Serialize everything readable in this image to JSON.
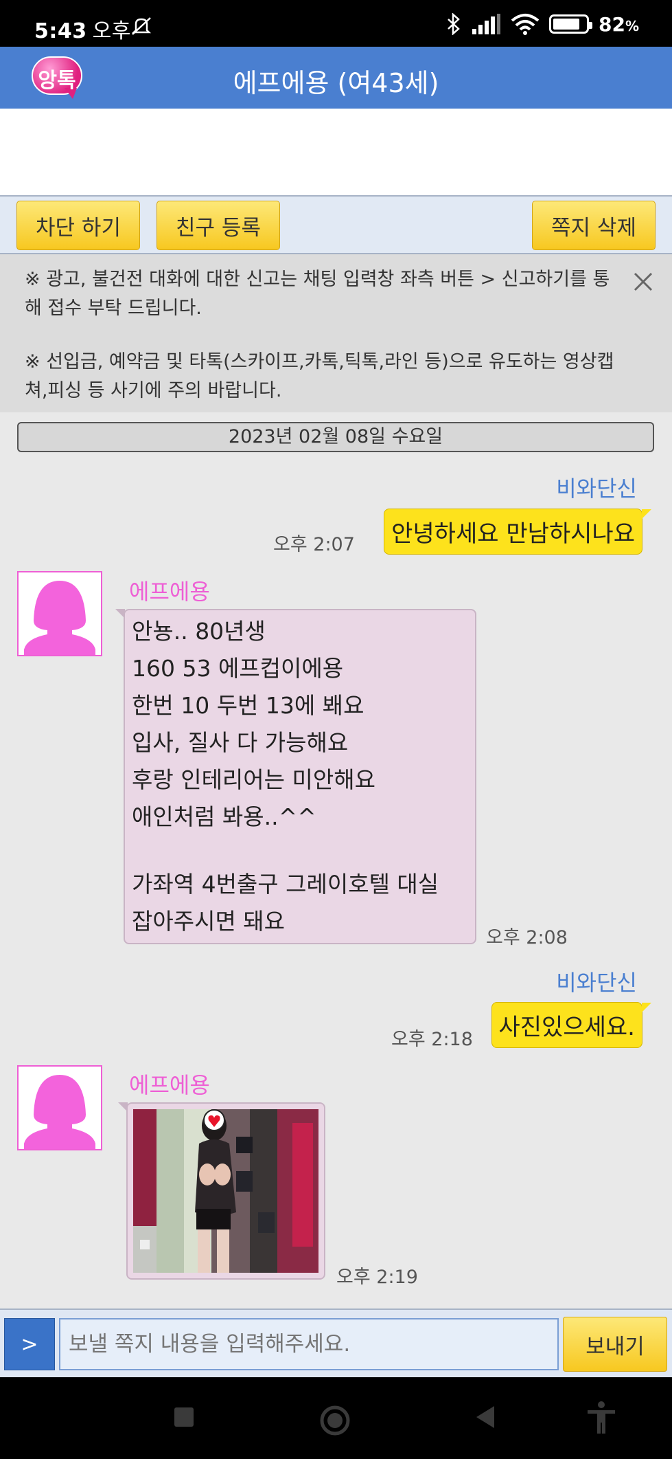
{
  "status_bar": {
    "time": "5:43",
    "ampm": "오후",
    "battery_percent": "82",
    "battery_level": 0.82
  },
  "header": {
    "logo_text": "앙톡",
    "title": "에프에용 (여43세)"
  },
  "toolbar": {
    "block_label": "차단 하기",
    "friend_label": "친구 등록",
    "delete_label": "쪽지 삭제"
  },
  "notice": {
    "line1": "※ 광고, 불건전 대화에 대한 신고는 채팅 입력창 좌측 버튼 > 신고하기를 통해 접수 부탁 드립니다.",
    "line2": "※ 선입금, 예약금 및 타톡(스카이프,카톡,틱톡,라인 등)으로 유도하는 영상캡쳐,피싱 등 사기에 주의 바랍니다."
  },
  "chat": {
    "date": "2023년 02월 08일 수요일",
    "my_name": "비와단신",
    "other_name": "에프에용",
    "messages": [
      {
        "from": "me",
        "text": "안녕하세요 만남하시나요",
        "time": "오후 2:07"
      },
      {
        "from": "other",
        "lines": [
          "안뇽.. 80년생",
          "160 53 에프컵이에용",
          "한번 10 두번 13에 봬요",
          "입사, 질사 다 가능해요",
          "후랑 인테리어는 미안해요",
          "애인처럼 봐용..^^",
          "",
          "가좌역 4번출구 그레이호텔 대실",
          "잡아주시면 돼요"
        ],
        "time": "오후 2:08"
      },
      {
        "from": "me",
        "text": "사진있으세요.",
        "time": "오후 2:18"
      },
      {
        "from": "other",
        "type": "photo",
        "time": "오후 2:19"
      }
    ]
  },
  "input": {
    "menu_button": ">",
    "placeholder": "보낼 쪽지 내용을 입력해주세요.",
    "send_label": "보내기"
  },
  "colors": {
    "header_blue": "#4a7fd0",
    "button_yellow": "#f7c820",
    "my_bubble": "#fde21c",
    "other_bubble": "#ead7e5",
    "other_name": "#ee5fd5"
  }
}
